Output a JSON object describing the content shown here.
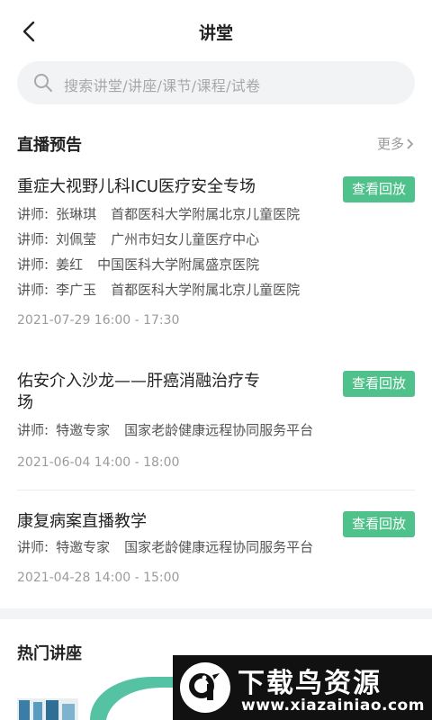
{
  "header": {
    "title": "讲堂",
    "back_icon": "chevron-left-icon"
  },
  "search": {
    "placeholder": "搜索讲堂/讲座/课节/课程/试卷",
    "icon": "search-icon"
  },
  "live_preview": {
    "title": "直播预告",
    "more_label": "更多",
    "items": [
      {
        "title": "重症大视野儿科ICU医疗安全专场",
        "button": "查看回放",
        "lecturers": [
          {
            "label": "讲师:",
            "name": "张琳琪",
            "org": "首都医科大学附属北京儿童医院"
          },
          {
            "label": "讲师:",
            "name": "刘佩莹",
            "org": "广州市妇女儿童医疗中心"
          },
          {
            "label": "讲师:",
            "name": "姜红",
            "org": "中国医科大学附属盛京医院"
          },
          {
            "label": "讲师:",
            "name": "李广玉",
            "org": "首都医科大学附属北京儿童医院"
          }
        ],
        "time": "2021-07-29 16:00 - 17:30"
      },
      {
        "title": "佑安介入沙龙——肝癌消融治疗专场",
        "button": "查看回放",
        "lecturers": [
          {
            "label": "讲师:",
            "name": "特邀专家",
            "org": "国家老龄健康远程协同服务平台"
          }
        ],
        "time": "2021-06-04 14:00 - 18:00"
      },
      {
        "title": "康复病案直播教学",
        "button": "查看回放",
        "lecturers": [
          {
            "label": "讲师:",
            "name": "特邀专家",
            "org": "国家老龄健康远程协同服务平台"
          }
        ],
        "time": "2021-04-28 14:00 - 15:00"
      }
    ]
  },
  "hot_lectures": {
    "title": "热门讲座"
  },
  "watermark": {
    "title": "下载鸟资源",
    "url": "www.xiazainiao.com"
  },
  "colors": {
    "accent": "#4fc18a",
    "search_bg": "#f2f3f5",
    "section_gap": "#f3f4f6"
  }
}
